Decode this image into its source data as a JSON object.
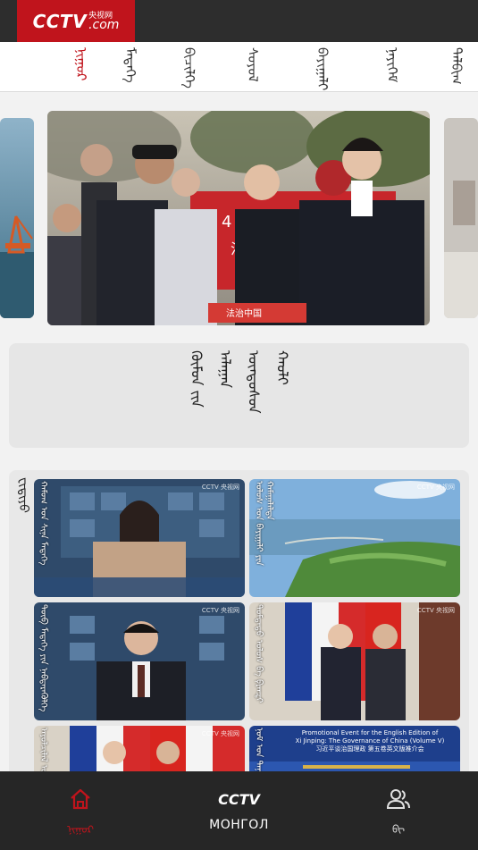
{
  "app": {
    "logo_text": "CCTV",
    "logo_sub_cn": "央视网",
    "logo_sub_com": ".com"
  },
  "tabs": [
    {
      "label": "ᠨᠢᠭᠤᠷ",
      "active": true
    },
    {
      "label": "ᠮᠡᠳᠡᠭᠡ"
    },
    {
      "label": "ᠪᠢᠴᠢᠯᠭᠡ"
    },
    {
      "label": "ᠰᠤᠶᠤᠯ"
    },
    {
      "label": "ᠪᠠᠶᠢᠭᠠᠯᠢ"
    },
    {
      "label": "ᠨᠡᠶᠢᠭᠡᠮ"
    },
    {
      "label": "ᠲᠠᠯᠪᠢᠭ"
    }
  ],
  "carousel": {
    "main_banner_number": "4",
    "main_banner_text": "法日",
    "main_footer_text": "法治中国"
  },
  "section": {
    "title_lines": [
      "ᠬᠦᠮᠦᠨ ᠵᠢᠨ ᠠᠯᠠᠭᠠᠨ",
      "ᠦᠨᠳᠦᠰᠦᠨ ᠬᠠᠤᠯᠢ"
    ]
  },
  "video_grid": {
    "label": "ᠸᠢᠳᠢᠶᠣ",
    "watermark": "CCTV 央视网",
    "items": [
      {
        "caption": "ᠬᠠᠮᠤᠭ ᠤᠨ ᠰᠢᠨᠡ ᠮᠡᠳᠡᠭᠡ"
      },
      {
        "caption": "ᠤᠯᠤᠰ ᠤᠨ ᠪᠠᠶᠢᠭᠠᠯᠢ ᠶᠢᠨ ᠬᠠᠮᠠᠭᠠᠯᠠᠯᠲᠠ"
      },
      {
        "caption": "ᠲᠥᠪ ᠮᠡᠳᠡᠭᠡ ᠶᠢᠨ ᠨᠡᠪᠲᠡᠷᠡᠭᠦᠯᠭᠡ"
      },
      {
        "caption": "ᠳᠤᠮᠳᠠᠳᠤ ᠤᠯᠤᠰ ᠪᠠ ᠹᠷᠠᠨᠼᠢ"
      },
      {
        "caption": "ᠠᠶᠤᠯᠴᠢᠯᠠᠯ ᠤᠨ ᠲᠤᠬᠠᠢ"
      },
      {
        "caption": "ᠨᠣᠮ ᠤᠨ ᠲᠠᠨᠢᠯᠴᠠᠭᠤᠯᠭ᠎ᠠ",
        "banner_en": "Promotional Event for the English Edition of",
        "banner_en2": "Xi Jinping: The Governance of China (Volume V)",
        "banner_cn": "习近平谈治国理政 第五卷英文版推介会"
      }
    ]
  },
  "bottom_nav": {
    "home_label": "ᠨᠢᠭᠤᠷ",
    "center_logo": "CCTV",
    "center_label": "МОНГОЛ",
    "user_label": "ᠪᠢ"
  },
  "colors": {
    "brand_red": "#c0141c",
    "topbar": "#2d2d2d",
    "bottombar": "#262626"
  }
}
